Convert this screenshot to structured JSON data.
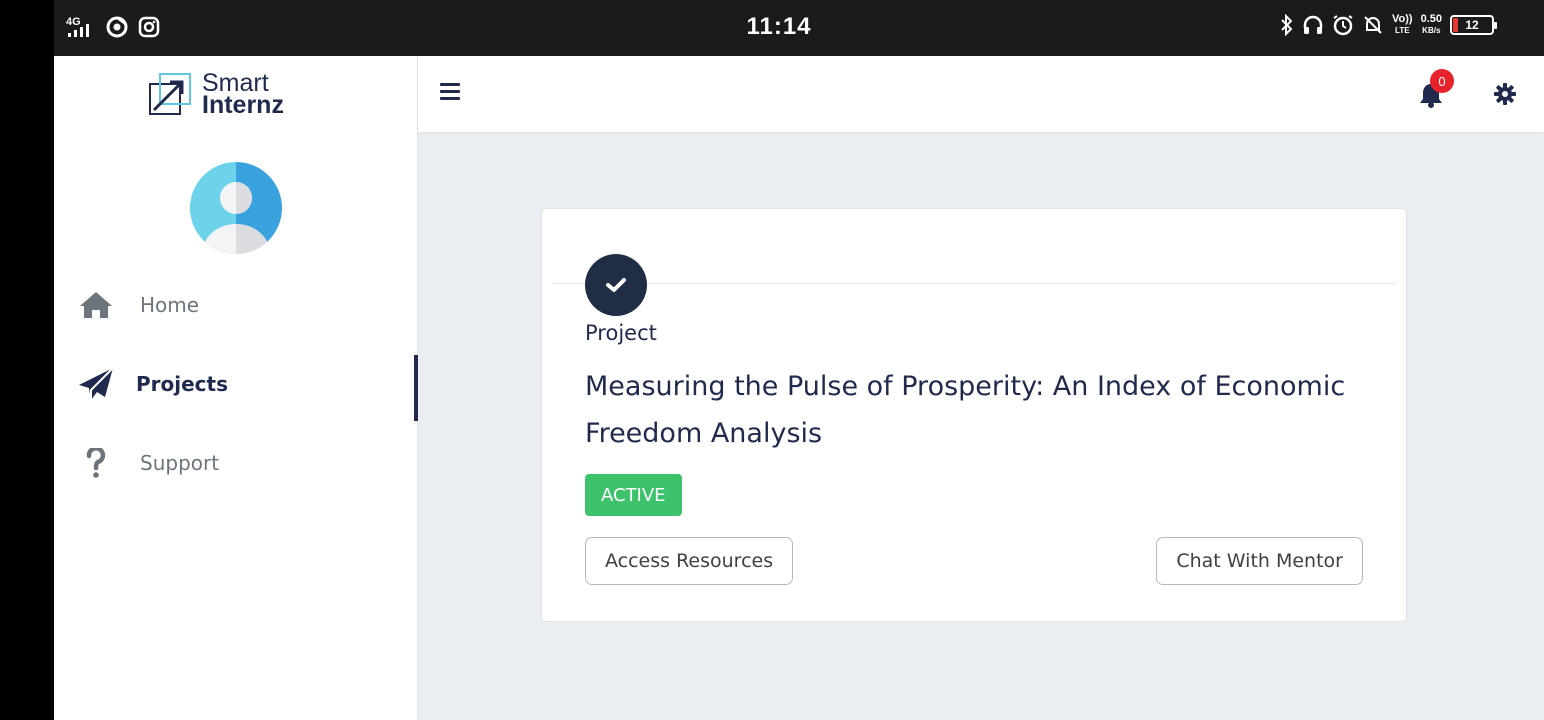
{
  "status_bar": {
    "time": "11:14",
    "network_left": "4G",
    "net_speed_value": "0.50",
    "net_speed_unit": "KB/s",
    "volte_top": "Vo))",
    "volte_bottom": "LTE",
    "battery_level": "12"
  },
  "app": {
    "logo_line1": "Smart",
    "logo_line2": "Internz",
    "notifications_count": "0"
  },
  "sidebar": {
    "items": [
      {
        "label": "Home",
        "icon": "home-icon",
        "active": false
      },
      {
        "label": "Projects",
        "icon": "paper-plane-icon",
        "active": true
      },
      {
        "label": "Support",
        "icon": "question-icon",
        "active": false
      }
    ]
  },
  "project_card": {
    "kicker": "Project",
    "title": "Measuring the Pulse of Prosperity: An Index of Economic Freedom Analysis",
    "status": "ACTIVE",
    "access_button": "Access Resources",
    "chat_button": "Chat With Mentor"
  },
  "colors": {
    "brand_navy": "#1f2a4d",
    "active_green": "#3cc26b",
    "badge_red": "#e8222b",
    "panel_bg": "#eaedf2"
  }
}
